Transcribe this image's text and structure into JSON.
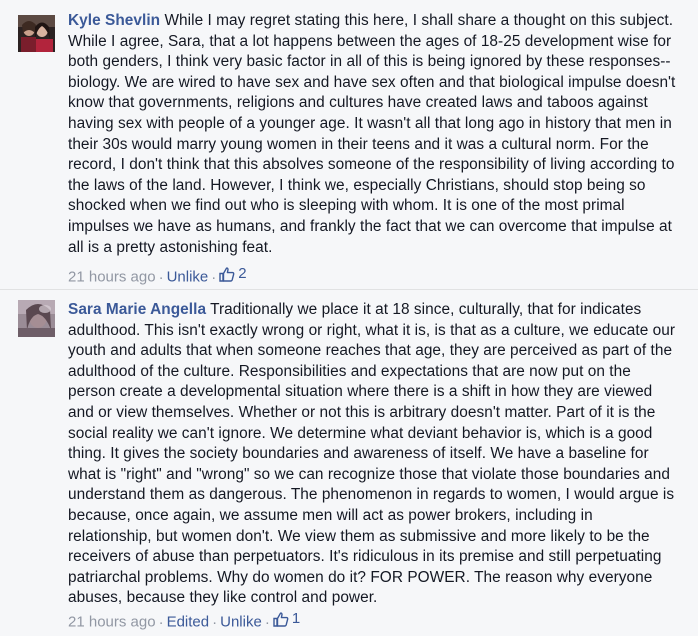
{
  "comments": [
    {
      "author": "Kyle Shevlin",
      "text": "While I may regret stating this here, I shall share a thought on this subject. While I agree, Sara, that a lot happens between the ages of 18-25 development wise for both genders, I think very basic factor in all of this is being ignored by these responses--biology. We are wired to have sex and have sex often and that biological impulse doesn't know that governments, religions and cultures have created laws and taboos against having sex with people of a younger age. It wasn't all that long ago in history that men in their 30s would marry young women in their teens and it was a cultural norm. For the record, I don't think that this absolves someone of the responsibility of living according to the laws of the land. However, I think we, especially Christians, should stop being so shocked when we find out who is sleeping with whom. It is one of the most primal impulses we have as humans, and frankly the fact that we can overcome that impulse at all is a pretty astonishing feat.",
      "timestamp": "21 hours ago",
      "unlike_label": "Unlike",
      "like_count": "2",
      "like_icon": "thumbs-up-icon"
    },
    {
      "author": "Sara Marie Angella",
      "text": "Traditionally we place it at 18 since, culturally, that for indicates adulthood. This isn't exactly wrong or right, what it is, is that as a culture, we educate our youth and adults that when someone reaches that age, they are perceived as part of the adulthood of the culture. Responsibilities and expectations that are now put on the person create a developmental situation where there is a shift in how they are viewed and or view themselves. Whether or not this is arbitrary doesn't matter. Part of it is the social reality we can't ignore. We determine what deviant behavior is, which is a good thing. It gives the society boundaries and awareness of itself. We have a baseline for what is \"right\" and \"wrong\" so we can recognize those that violate those boundaries and understand them as dangerous. The phenomenon in regards to women, I would argue is because, once again, we assume men will act as power brokers, including in relationship, but women don't. We view them as submissive and more likely to be the receivers of abuse than perpetuators. It's ridiculous in its premise and still perpetuating patriarchal problems. Why do women do it? FOR POWER. The reason why everyone abuses, because they like control and power.",
      "timestamp": "21 hours ago",
      "edited_label": "Edited",
      "unlike_label": "Unlike",
      "like_count": "1",
      "like_icon": "thumbs-up-icon"
    }
  ],
  "separator": "·",
  "colors": {
    "background": "#f6f7f9",
    "author_link": "#3b5998",
    "body_text": "#141823",
    "meta_text": "#9197a3"
  }
}
